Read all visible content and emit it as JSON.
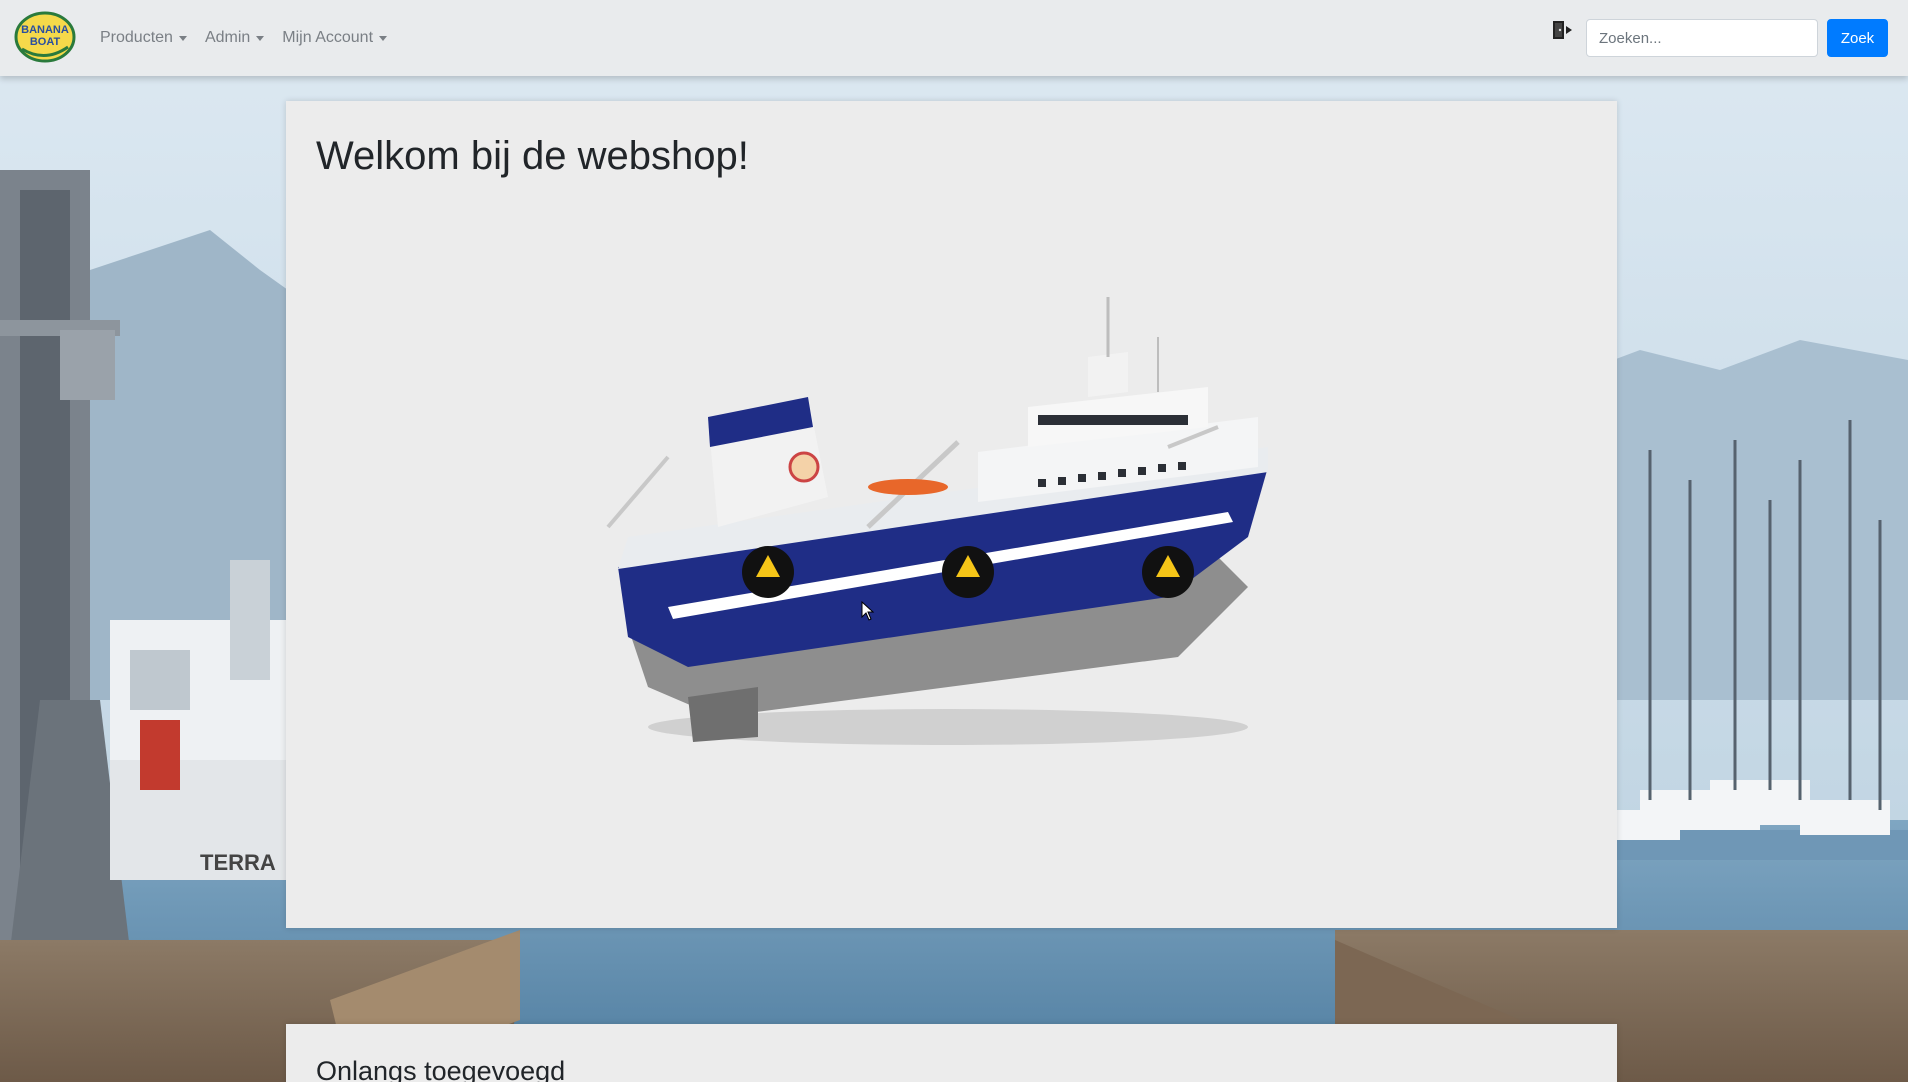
{
  "navbar": {
    "brand_text_top": "BANANA",
    "brand_text_bottom": "BOAT",
    "menu": [
      {
        "label": "Producten"
      },
      {
        "label": "Admin"
      },
      {
        "label": "Mijn Account"
      }
    ],
    "search": {
      "placeholder": "Zoeken...",
      "value": ""
    },
    "search_button_label": "Zoek"
  },
  "welcome": {
    "title": "Welkom bij de webshop!"
  },
  "recent": {
    "title": "Onlangs toegevoegd"
  },
  "ship": {
    "hull_name": "TERRA"
  },
  "colors": {
    "primary": "#007bff",
    "navbar_bg": "#e9ebed",
    "card_bg": "#ececec",
    "hull_blue": "#1f2d86"
  },
  "icons": {
    "logout": "logout-icon",
    "caret": "chevron-down-icon",
    "logo": "banana-boat-logo"
  }
}
